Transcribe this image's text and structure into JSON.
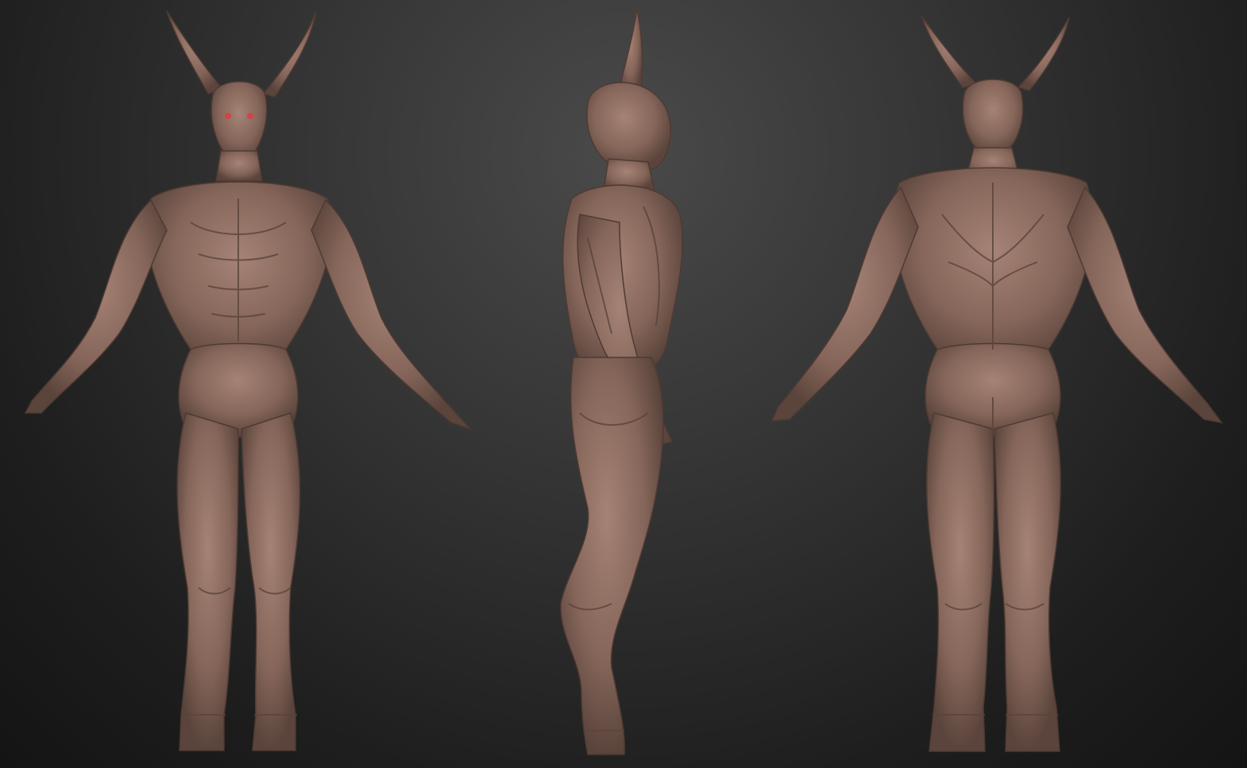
{
  "scene": {
    "background_top": "#3f3f3f",
    "background_bottom": "#151515",
    "clay_color": "#8a6a5e",
    "clay_shadow": "#4e3a33",
    "clay_highlight": "#b08f82",
    "eye_color": "#d2434a"
  },
  "views": [
    {
      "name": "front-view"
    },
    {
      "name": "side-view"
    },
    {
      "name": "back-view"
    }
  ]
}
